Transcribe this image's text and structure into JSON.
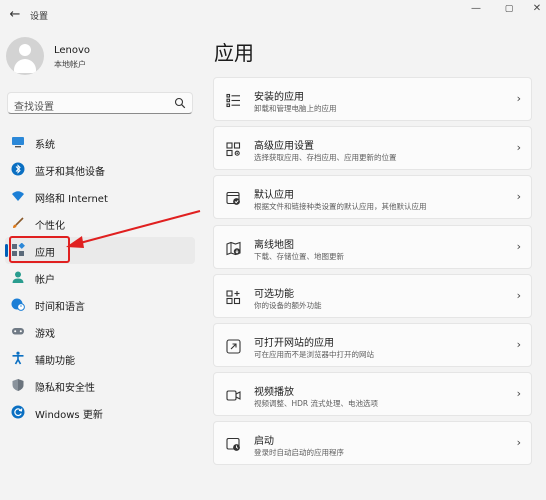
{
  "window": {
    "title": "设置",
    "back": "←",
    "minimize": "—",
    "maximize": "▢",
    "close": "✕"
  },
  "profile": {
    "name": "Lenovo",
    "account_type": "本地帐户"
  },
  "search": {
    "placeholder": "查找设置"
  },
  "sidebar": {
    "items": [
      {
        "label": "系统",
        "icon": "display-icon"
      },
      {
        "label": "蓝牙和其他设备",
        "icon": "bluetooth-icon"
      },
      {
        "label": "网络和 Internet",
        "icon": "wifi-icon"
      },
      {
        "label": "个性化",
        "icon": "brush-icon"
      },
      {
        "label": "应用",
        "icon": "apps-icon",
        "selected": true
      },
      {
        "label": "帐户",
        "icon": "person-icon"
      },
      {
        "label": "时间和语言",
        "icon": "globe-clock-icon"
      },
      {
        "label": "游戏",
        "icon": "gamepad-icon"
      },
      {
        "label": "辅助功能",
        "icon": "accessibility-icon"
      },
      {
        "label": "隐私和安全性",
        "icon": "shield-icon"
      },
      {
        "label": "Windows 更新",
        "icon": "update-icon"
      }
    ]
  },
  "main": {
    "title": "应用",
    "cards": [
      {
        "title": "安装的应用",
        "desc": "卸载和管理电脑上的应用",
        "icon": "list-icon"
      },
      {
        "title": "高级应用设置",
        "desc": "选择获取应用、存档应用、应用更新的位置",
        "icon": "app-settings-icon"
      },
      {
        "title": "默认应用",
        "desc": "根据文件和链接种类设置的默认应用，其他默认应用",
        "icon": "default-app-icon"
      },
      {
        "title": "离线地图",
        "desc": "下载、存储位置、地图更新",
        "icon": "map-icon"
      },
      {
        "title": "可选功能",
        "desc": "你的设备的额外功能",
        "icon": "add-grid-icon"
      },
      {
        "title": "可打开网站的应用",
        "desc": "可在应用而不是浏览器中打开的网站",
        "icon": "open-web-icon"
      },
      {
        "title": "视频播放",
        "desc": "视频调整、HDR 流式处理、电池选项",
        "icon": "video-icon"
      },
      {
        "title": "启动",
        "desc": "登录时自动启动的应用程序",
        "icon": "startup-icon"
      }
    ]
  },
  "colors": {
    "accent": "#005fb8",
    "annotation_red": "#e02020",
    "background": "#f3f3f3",
    "card": "#fbfbfb"
  }
}
